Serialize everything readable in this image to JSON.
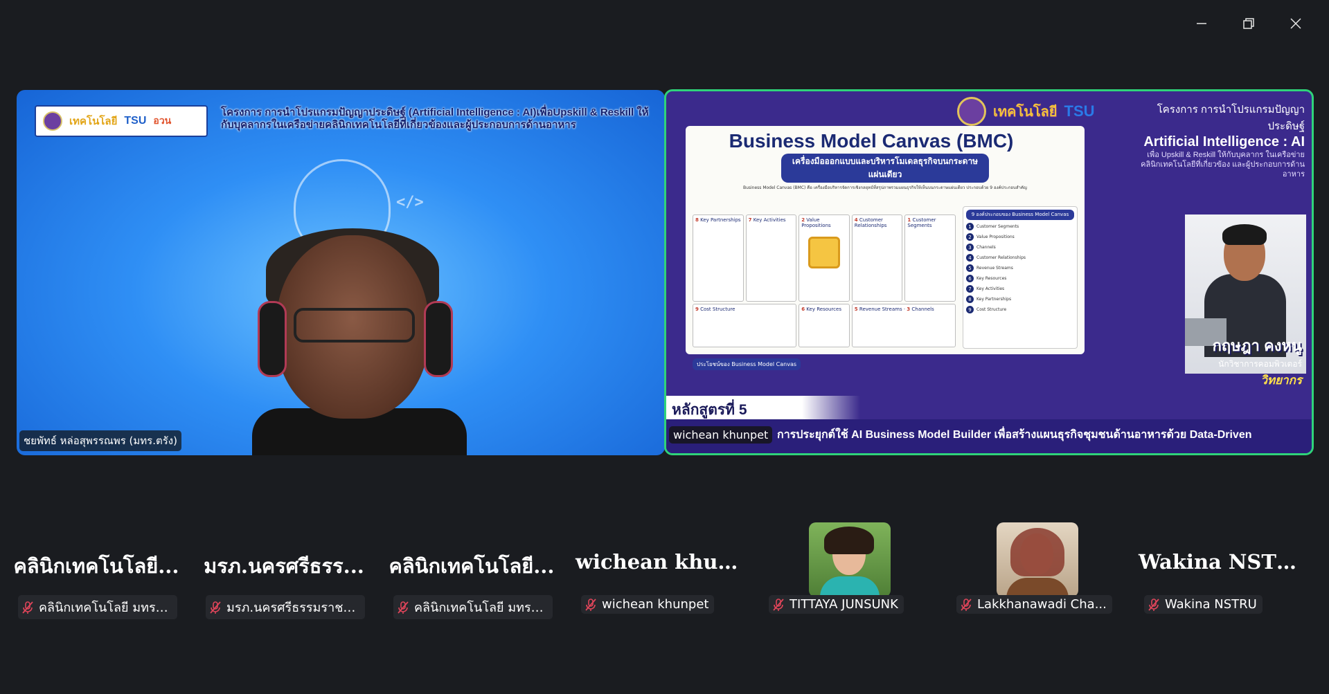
{
  "window": {
    "minimize_glyph": "—",
    "restore_glyph": "❐",
    "close_glyph": "✕"
  },
  "colors": {
    "active_speaker_border": "#2fd37a",
    "muted_icon": "#e0455a",
    "background": "#1a1c20"
  },
  "left_tile": {
    "logo_text": "เทคโนโลยี",
    "logo_tsu": "TSU",
    "logo_orange": "อวน",
    "title": "โครงการ การนำโปรแกรมปัญญาประดิษฐ์ (Artificial Intelligence : AI)เพื่อUpskill & Reskill ให้กับบุคลากรในเครือข่ายคลินิกเทคโนโลยีที่เกี่ยวข้องและผู้ประกอบการด้านอาหาร",
    "code_badge": "</>",
    "name_tag": "ชยพัทธ์ หล่อสุพรรณพร (มทร.ตรัง)"
  },
  "right_tile": {
    "logo_text": "เทคโนโลยี",
    "logo_tsu": "TSU",
    "top_title_1": "โครงการ การนำโปรแกรมปัญญาประดิษฐ์",
    "top_title_2": "Artificial Intelligence : AI",
    "top_title_3": "เพื่อ Upskill & Reskill ให้กับบุคลากร ในเครือข่ายคลินิกเทคโนโลยีที่เกี่ยวข้อง และผู้ประกอบการด้านอาหาร",
    "bmc_title": "Business Model Canvas (BMC)",
    "bmc_subtitle": "เครื่องมือออกแบบและบริหารโมเดลธุรกิจบนกระดาษแผ่นเดียว",
    "bmc_description": "Business Model Canvas (BMC) คือ เครื่องมือบริหารจัดการเชิงกลยุทธ์ที่สรุปภาพรวมแผนธุรกิจให้เห็นบนกระดาษแผ่นเดียว ประกอบด้วย 9 องค์ประกอบสำคัญ",
    "cells": [
      {
        "num": "8",
        "label": "Key Partnerships"
      },
      {
        "num": "7",
        "label": "Key Activities"
      },
      {
        "num": "2",
        "label": "Value Propositions"
      },
      {
        "num": "4",
        "label": "Customer Relationships"
      },
      {
        "num": "1",
        "label": "Customer Segments"
      },
      {
        "num": "6",
        "label": "Key Resources"
      },
      {
        "num": "3",
        "label": "Channels"
      },
      {
        "num": "9",
        "label": "Cost Structure"
      },
      {
        "num": "5",
        "label": "Revenue Streams"
      }
    ],
    "side_header": "9 องค์ประกอบของ Business Model Canvas",
    "side_items": [
      {
        "num": "1",
        "label": "Customer Segments"
      },
      {
        "num": "2",
        "label": "Value Propositions"
      },
      {
        "num": "3",
        "label": "Channels"
      },
      {
        "num": "4",
        "label": "Customer Relationships"
      },
      {
        "num": "5",
        "label": "Revenue Streams"
      },
      {
        "num": "6",
        "label": "Key Resources"
      },
      {
        "num": "7",
        "label": "Key Activities"
      },
      {
        "num": "8",
        "label": "Key Partnerships"
      },
      {
        "num": "9",
        "label": "Cost Structure"
      }
    ],
    "benefits_header": "ประโยชน์ของ Business Model Canvas",
    "presenter_name": "กฤษฎา คงหนู",
    "presenter_role": "นักวิชาการคอมพิวเตอร์",
    "presenter_title": "วิทยากร",
    "course_label": "หลักสูตรที่ 5",
    "course_desc": "การประยุกต์ใช้ AI Business Model Builder เพื่อสร้างแผนธุรกิจชุมชนด้านอาหารด้วย Data-Driven",
    "name_tag": "wichean khunpet"
  },
  "participants": [
    {
      "display": "คลินิกเทคโนโลยี...",
      "label": "คลินิกเทคโนโลยี มทร.ศ...",
      "has_photo": false
    },
    {
      "display": "มรภ.นครศรีธรร...",
      "label": "มรภ.นครศรีธรรมราช คิ...",
      "has_photo": false
    },
    {
      "display": "คลินิกเทคโนโลยี...",
      "label": "คลินิกเทคโนโลยี มทร.ศ...",
      "has_photo": false
    },
    {
      "display": "wichean khunpet",
      "label": "wichean khunpet",
      "has_photo": false
    },
    {
      "display": "",
      "label": "TITTAYA JUNSUNK",
      "has_photo": true,
      "photo_bg": "#6a9d4c"
    },
    {
      "display": "",
      "label": "Lakkhanawadi Cha...",
      "has_photo": true,
      "photo_bg": "#c9b9a2"
    },
    {
      "display": "Wakina NSTRU",
      "label": "Wakina NSTRU",
      "has_photo": false
    }
  ]
}
